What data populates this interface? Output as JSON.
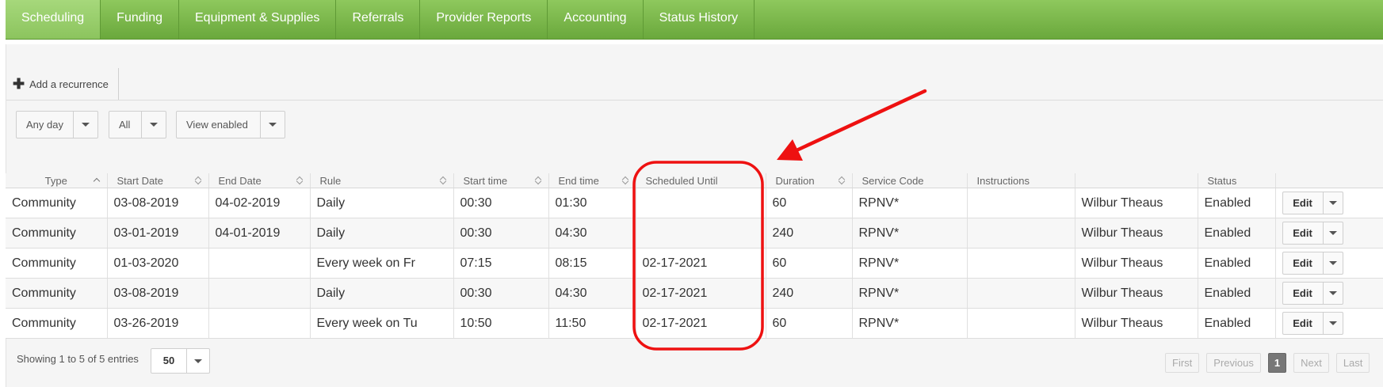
{
  "tabs": [
    {
      "label": "Scheduling",
      "active": true
    },
    {
      "label": "Funding"
    },
    {
      "label": "Equipment & Supplies"
    },
    {
      "label": "Referrals"
    },
    {
      "label": "Provider Reports"
    },
    {
      "label": "Accounting"
    },
    {
      "label": "Status History"
    }
  ],
  "toolbar": {
    "add_recurrence_label": "Add a recurrence",
    "add_icon": "plus-icon"
  },
  "filters": {
    "day": "Any day",
    "type": "All",
    "enabled": "View enabled"
  },
  "table": {
    "columns": [
      "Type",
      "Start Date",
      "End Date",
      "Rule",
      "Start time",
      "End time",
      "Scheduled Until",
      "Duration",
      "Service Code",
      "Instructions",
      "",
      "Status"
    ],
    "rows": [
      {
        "type": "Community",
        "start_date": "03-08-2019",
        "end_date": "04-02-2019",
        "rule": "Daily",
        "start_time": "00:30",
        "end_time": "01:30",
        "scheduled_until": "",
        "duration": "60",
        "service_code": "RPNV*",
        "instructions": "",
        "provider": "Wilbur Theaus",
        "status": "Enabled"
      },
      {
        "type": "Community",
        "start_date": "03-01-2019",
        "end_date": "04-01-2019",
        "rule": "Daily",
        "start_time": "00:30",
        "end_time": "04:30",
        "scheduled_until": "",
        "duration": "240",
        "service_code": "RPNV*",
        "instructions": "",
        "provider": "Wilbur Theaus",
        "status": "Enabled"
      },
      {
        "type": "Community",
        "start_date": "01-03-2020",
        "end_date": "",
        "rule": "Every week on Fr",
        "start_time": "07:15",
        "end_time": "08:15",
        "scheduled_until": "02-17-2021",
        "duration": "60",
        "service_code": "RPNV*",
        "instructions": "",
        "provider": "Wilbur Theaus",
        "status": "Enabled"
      },
      {
        "type": "Community",
        "start_date": "03-08-2019",
        "end_date": "",
        "rule": "Daily",
        "start_time": "00:30",
        "end_time": "04:30",
        "scheduled_until": "02-17-2021",
        "duration": "240",
        "service_code": "RPNV*",
        "instructions": "",
        "provider": "Wilbur Theaus",
        "status": "Enabled"
      },
      {
        "type": "Community",
        "start_date": "03-26-2019",
        "end_date": "",
        "rule": "Every week on Tu",
        "start_time": "10:50",
        "end_time": "11:50",
        "scheduled_until": "02-17-2021",
        "duration": "60",
        "service_code": "RPNV*",
        "instructions": "",
        "provider": "Wilbur Theaus",
        "status": "Enabled"
      }
    ],
    "edit_label": "Edit"
  },
  "footer": {
    "info": "Showing 1 to 5 of 5 entries",
    "page_size": "50",
    "pager": {
      "first": "First",
      "previous": "Previous",
      "current": "1",
      "next": "Next",
      "last": "Last"
    }
  },
  "annotation": {
    "color": "#ee1111"
  }
}
